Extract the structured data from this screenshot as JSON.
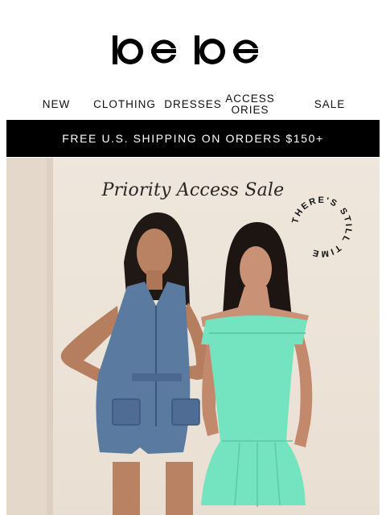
{
  "brand": {
    "name": "bebe"
  },
  "nav": {
    "items": [
      {
        "label": "NEW"
      },
      {
        "label": "CLOTHING"
      },
      {
        "label": "DRESSES"
      },
      {
        "label": "ACCESSORIES"
      },
      {
        "label": "SALE"
      }
    ]
  },
  "banner": {
    "text": "FREE U.S. SHIPPING ON ORDERS $150+"
  },
  "hero": {
    "headline": "Priority Access Sale",
    "badge_text": "THERE'S STILL TIME",
    "colors": {
      "dress": "#74e3bf",
      "denim": "#5b7aa0",
      "wall": "#ebe1d6"
    }
  }
}
